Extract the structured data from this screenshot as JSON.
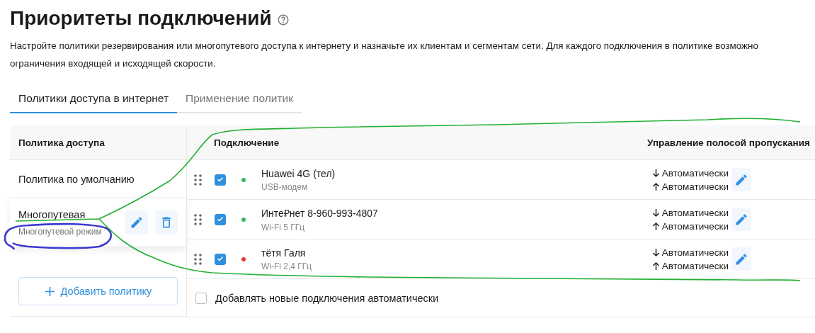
{
  "title": "Приоритеты подключений",
  "description_lines": [
    "Настройте политики резервирования или многопутевого доступа к интернету и назначьте их клиентам и сегментам сети. Для каждого подключения в политике возможно",
    "ограничения входящей и исходящей скорости."
  ],
  "tabs": [
    {
      "label": "Политики доступа в интернет",
      "selected": true
    },
    {
      "label": "Применение политик",
      "selected": false
    }
  ],
  "policies": {
    "header": "Политика доступа",
    "items": [
      {
        "name": "Политика по умолчанию",
        "selected": false
      },
      {
        "name": "Многопутевая",
        "subtitle": "Многопутевой режим",
        "selected": true
      }
    ],
    "add_button": "Добавить политику"
  },
  "connections": {
    "columns": [
      "Подключение",
      "Управление полосой пропускания"
    ],
    "rows": [
      {
        "name": "Huawei 4G (тел)",
        "type": "USB-модем",
        "checked": true,
        "color": "#3cb55a",
        "download": "Автоматически",
        "upload": "Автоматически"
      },
      {
        "name": "Инте₽нет 8-960-993-4807",
        "type": "Wi-Fi 5 ГГц",
        "checked": true,
        "color": "#3cb55a",
        "download": "Автоматически",
        "upload": "Автоматически"
      },
      {
        "name": "тётя Галя",
        "type": "Wi-Fi 2,4 ГГц",
        "checked": true,
        "color": "#e0383b",
        "download": "Автоматически",
        "upload": "Автоматически"
      }
    ],
    "auto_add": {
      "label": "Добавлять новые подключения автоматически",
      "checked": false
    }
  }
}
